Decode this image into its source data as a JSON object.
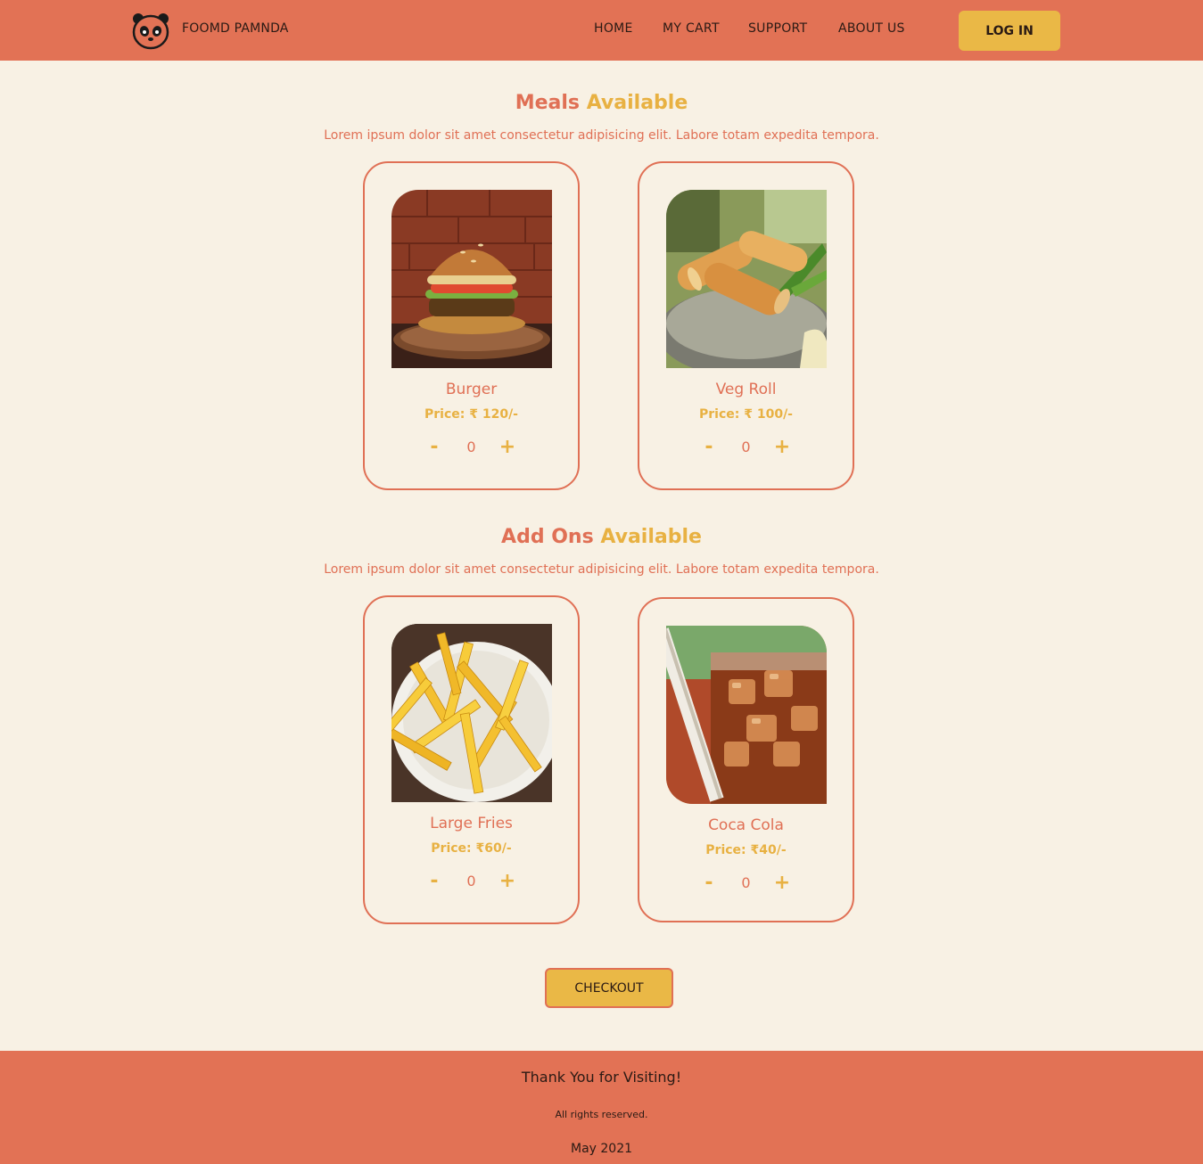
{
  "header": {
    "brand": "FOOMD PAMNDA",
    "logo_icon": "panda-icon",
    "nav": [
      {
        "label": "HOME"
      },
      {
        "label": "MY CART"
      },
      {
        "label": "SUPPORT"
      },
      {
        "label": "ABOUT US"
      }
    ],
    "login_label": "LOG IN"
  },
  "meals": {
    "title_part1": "Meals",
    "title_part2": "Available",
    "subtitle": "Lorem ipsum dolor sit amet consectetur adipisicing elit. Labore totam expedita tempora.",
    "items": [
      {
        "name": "Burger",
        "price": "Price: ₹ 120/-",
        "qty": "0",
        "minus": "-",
        "plus": "+",
        "image_icon": "burger-image"
      },
      {
        "name": "Veg Roll",
        "price": "Price: ₹ 100/-",
        "qty": "0",
        "minus": "-",
        "plus": "+",
        "image_icon": "veg-roll-image"
      }
    ]
  },
  "addons": {
    "title_part1": "Add Ons",
    "title_part2": "Available",
    "subtitle": "Lorem ipsum dolor sit amet consectetur adipisicing elit. Labore totam expedita tempora.",
    "items": [
      {
        "name": "Large Fries",
        "price": "Price: ₹60/-",
        "qty": "0",
        "minus": "-",
        "plus": "+",
        "image_icon": "fries-image"
      },
      {
        "name": "Coca Cola",
        "price": "Price: ₹40/-",
        "qty": "0",
        "minus": "-",
        "plus": "+",
        "image_icon": "cola-image"
      }
    ]
  },
  "checkout_label": "CHECKOUT",
  "footer": {
    "thanks": "Thank You for Visiting!",
    "rights": "All rights reserved.",
    "date": "May 2021"
  },
  "colors": {
    "accent": "#e27255",
    "gold": "#eab846",
    "background": "#f8f1e4"
  }
}
